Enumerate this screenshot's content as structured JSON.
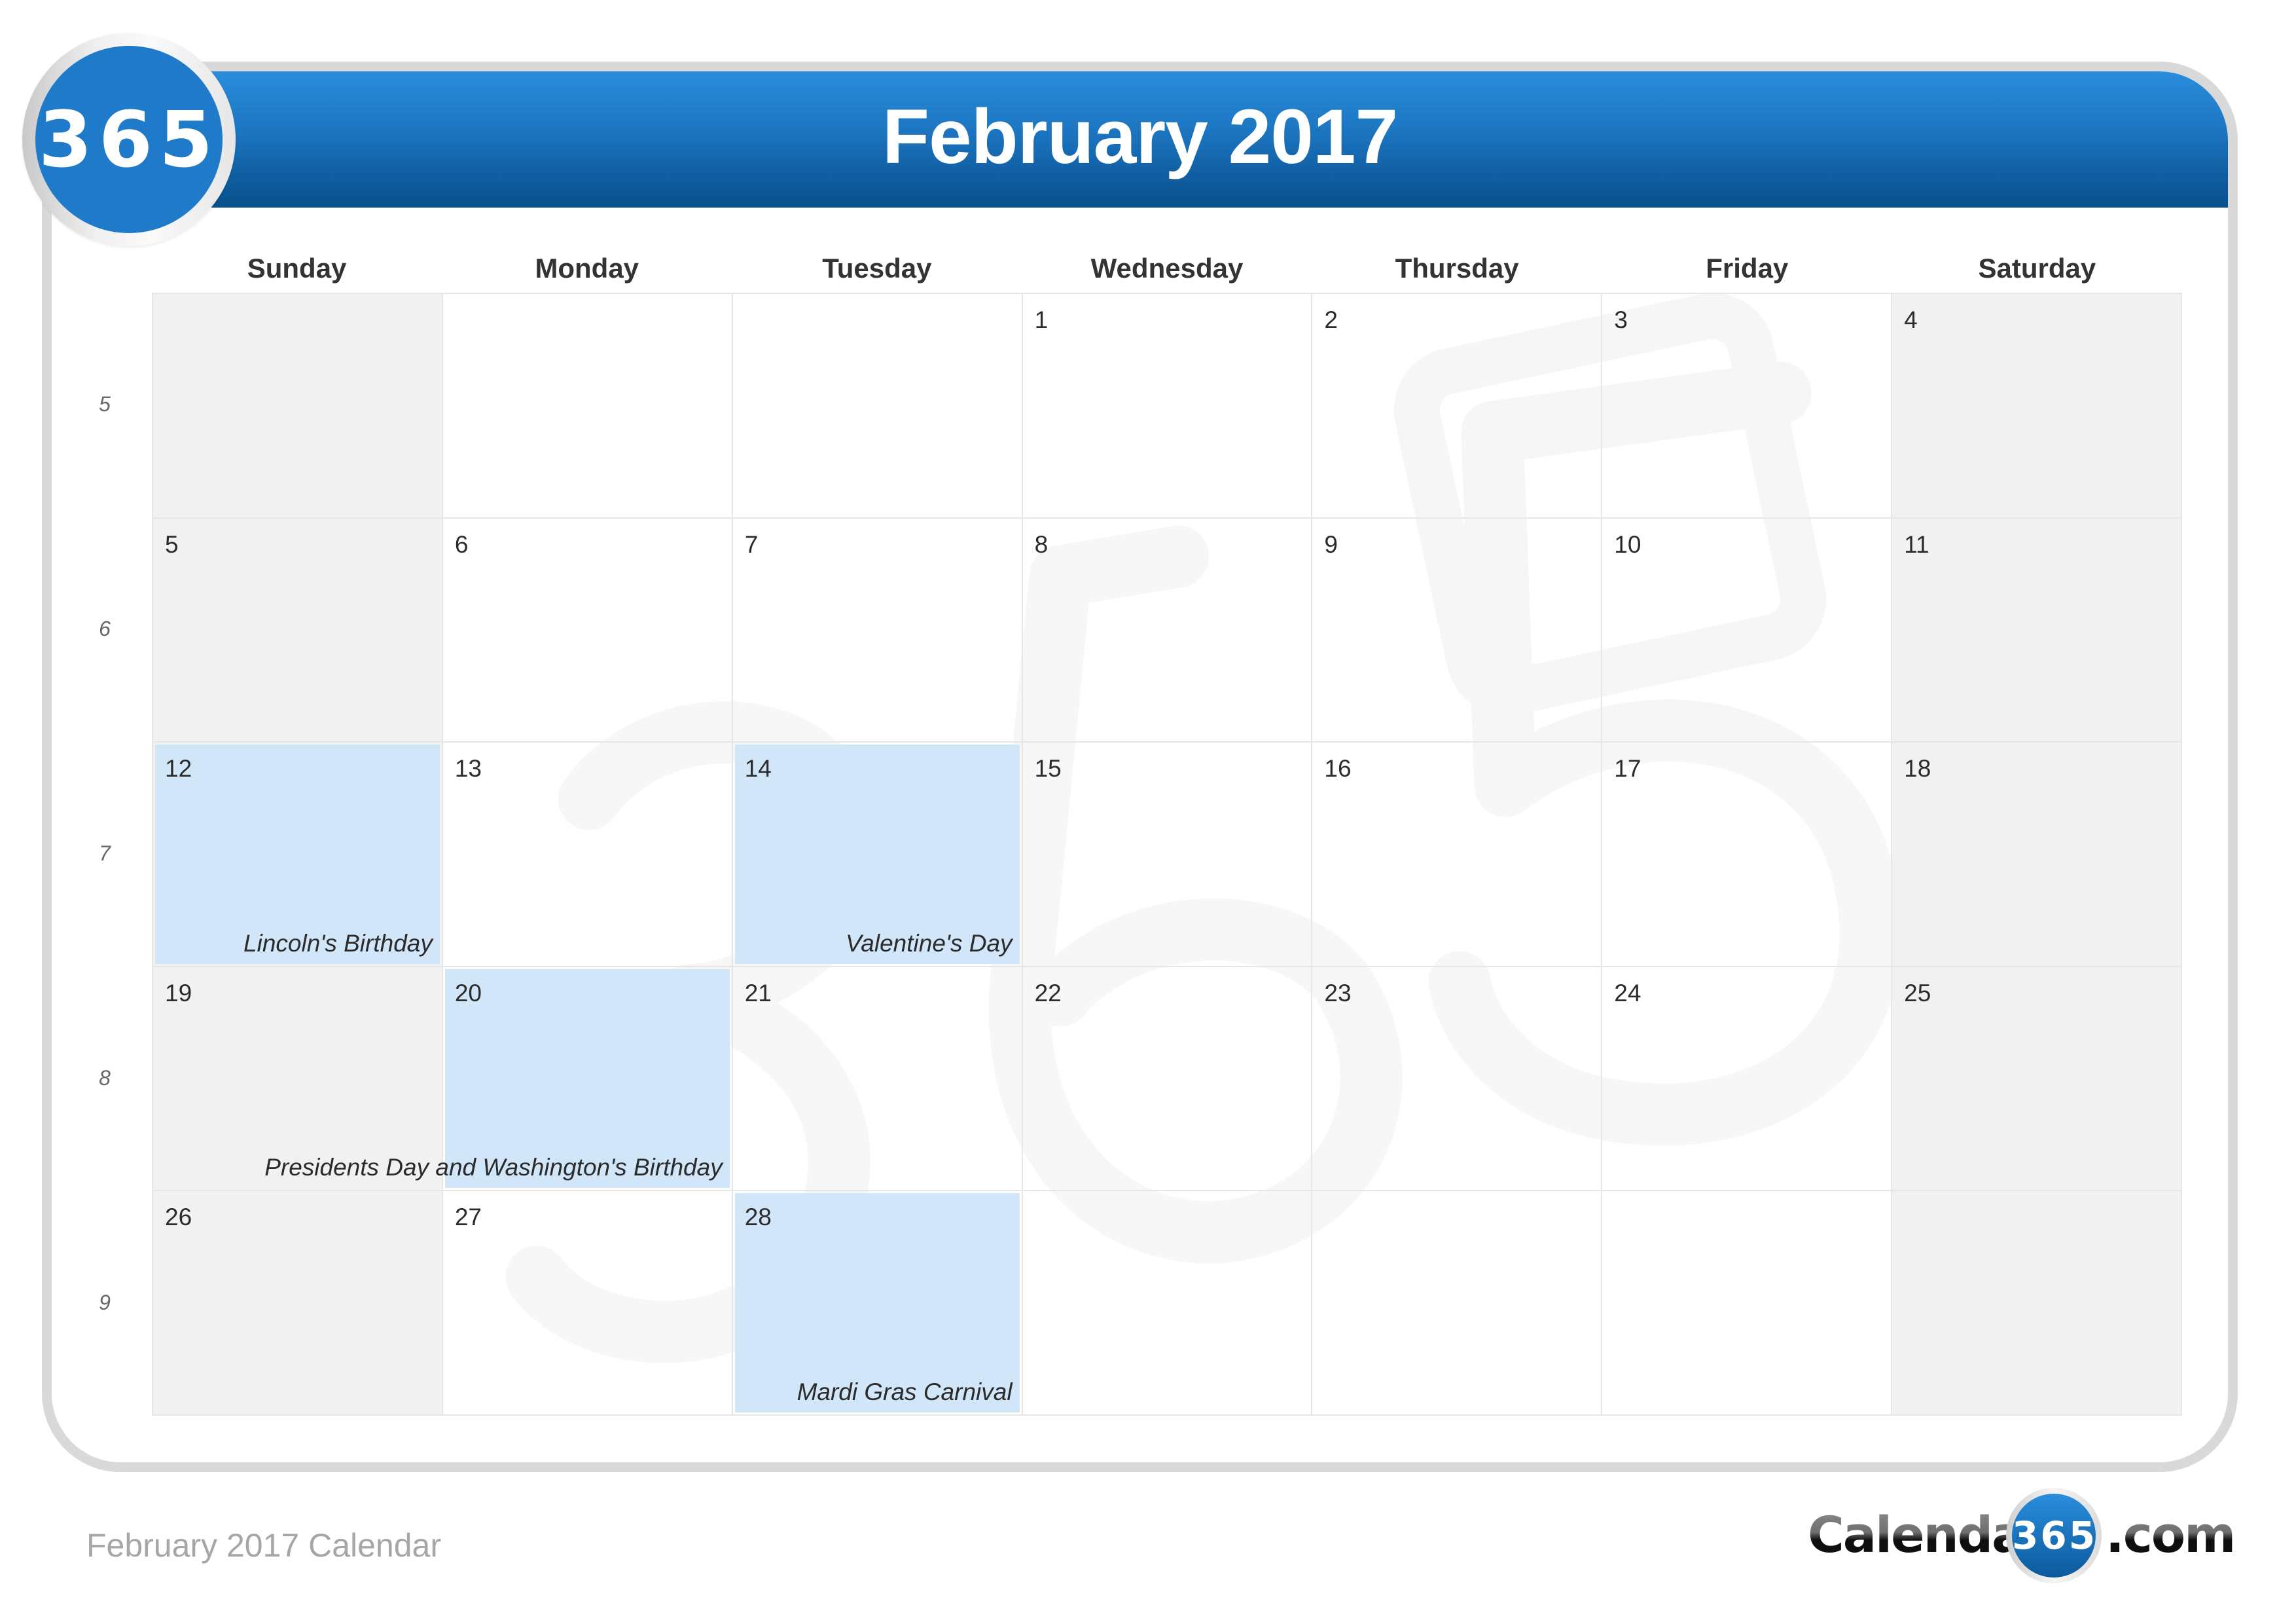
{
  "header": {
    "logo_text": "365",
    "title": "February 2017"
  },
  "colors": {
    "header_top": "#2a8ddc",
    "header_bottom": "#07508c",
    "holiday_fill": "#d1e6f9",
    "weekend_fill": "#efefef",
    "grid_line": "#e6e6e6",
    "frame": "#d9d9d9"
  },
  "weekdays": [
    "Sunday",
    "Monday",
    "Tuesday",
    "Wednesday",
    "Thursday",
    "Friday",
    "Saturday"
  ],
  "week_numbers": [
    "5",
    "6",
    "7",
    "8",
    "9"
  ],
  "weeks": [
    [
      {
        "day": "",
        "weekend": true
      },
      {
        "day": ""
      },
      {
        "day": ""
      },
      {
        "day": "1"
      },
      {
        "day": "2"
      },
      {
        "day": "3"
      },
      {
        "day": "4",
        "weekend": true
      }
    ],
    [
      {
        "day": "5",
        "weekend": true
      },
      {
        "day": "6"
      },
      {
        "day": "7"
      },
      {
        "day": "8"
      },
      {
        "day": "9"
      },
      {
        "day": "10"
      },
      {
        "day": "11",
        "weekend": true
      }
    ],
    [
      {
        "day": "12",
        "weekend": true,
        "holiday": "Lincoln's Birthday"
      },
      {
        "day": "13"
      },
      {
        "day": "14",
        "holiday": "Valentine's Day"
      },
      {
        "day": "15"
      },
      {
        "day": "16"
      },
      {
        "day": "17"
      },
      {
        "day": "18",
        "weekend": true
      }
    ],
    [
      {
        "day": "19",
        "weekend": true
      },
      {
        "day": "20",
        "holiday": "Presidents Day and Washington's Birthday"
      },
      {
        "day": "21"
      },
      {
        "day": "22"
      },
      {
        "day": "23"
      },
      {
        "day": "24"
      },
      {
        "day": "25",
        "weekend": true
      }
    ],
    [
      {
        "day": "26",
        "weekend": true
      },
      {
        "day": "27"
      },
      {
        "day": "28",
        "holiday": "Mardi Gras Carnival"
      },
      {
        "day": ""
      },
      {
        "day": ""
      },
      {
        "day": ""
      },
      {
        "day": "",
        "weekend": true
      }
    ]
  ],
  "footer": {
    "caption": "February 2017 Calendar",
    "brand_left": "Calendar-",
    "brand_circle": "365",
    "brand_right": ".com"
  }
}
